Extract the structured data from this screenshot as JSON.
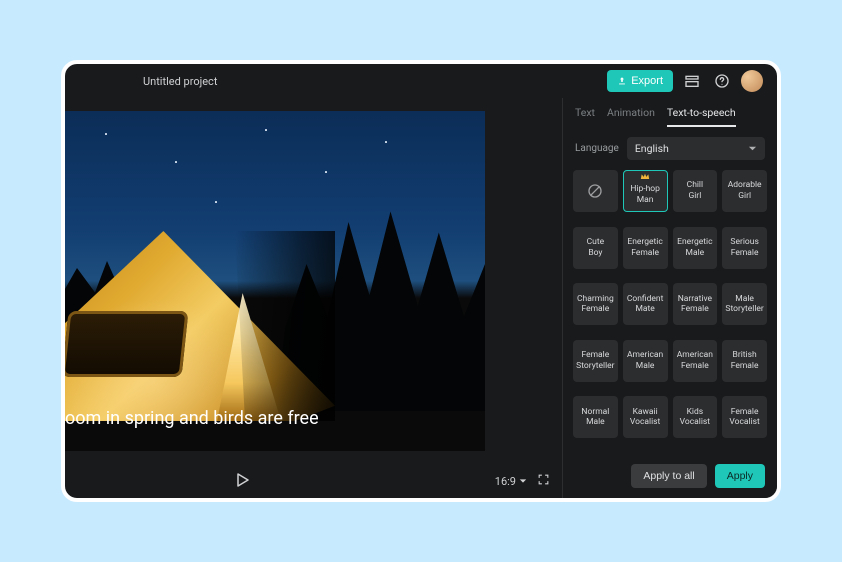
{
  "header": {
    "project_title": "Untitled project",
    "export_label": "Export"
  },
  "preview": {
    "caption_text": "oom in spring and birds are free",
    "aspect_label": "16:9"
  },
  "panel": {
    "tabs": {
      "text": "Text",
      "animation": "Animation",
      "tts": "Text-to-speech"
    },
    "language_label": "Language",
    "language_value": "English",
    "voices": [
      "Hip-hop Man",
      "Chill Girl",
      "Adorable Girl",
      "Cute Boy",
      "Energetic Female",
      "Energetic Male",
      "Serious Female",
      "Charming Female",
      "Confident Mate",
      "Narrative Female",
      "Male Storyteller",
      "Female Storyteller",
      "American Male",
      "American Female",
      "British Female",
      "Normal Male",
      "Kawaii Vocalist",
      "Kids Vocalist",
      "Female Vocalist"
    ],
    "selected_voice_index": 0,
    "apply_all_label": "Apply to all",
    "apply_label": "Apply"
  },
  "colors": {
    "accent": "#1ec7b7"
  }
}
